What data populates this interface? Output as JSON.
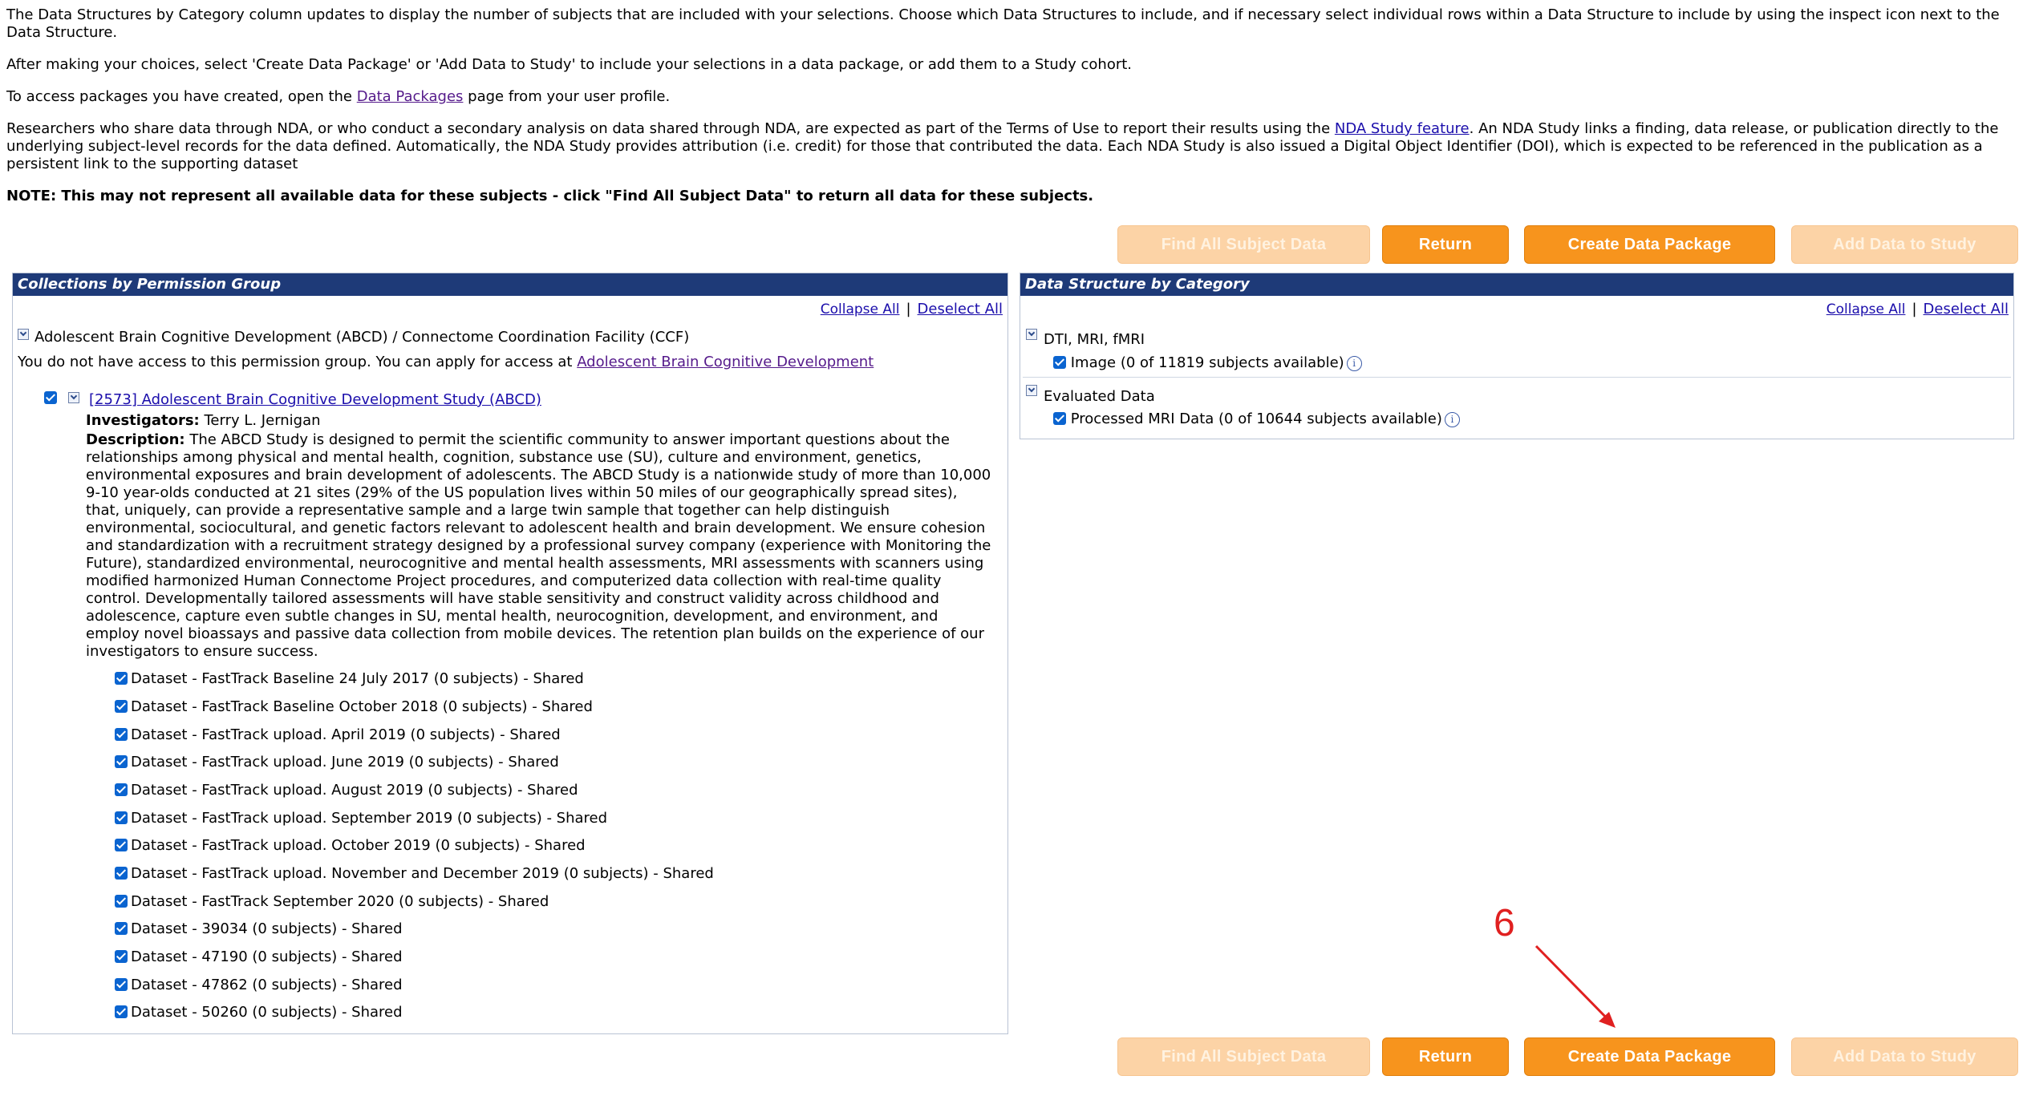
{
  "intro": {
    "p1": "The Data Structures by Category column updates to display the number of subjects that are included with your selections. Choose which Data Structures to include, and if necessary select individual rows within a Data Structure to include by using the inspect icon next to the Data Structure.",
    "p2": "After making your choices, select 'Create Data Package' or 'Add Data to Study' to include your selections in a data package, or add them to a Study cohort.",
    "p3_pre": "To access packages you have created, open the ",
    "p3_link": "Data Packages",
    "p3_post": " page from your user profile.",
    "p4_pre": "Researchers who share data through NDA, or who conduct a secondary analysis on data shared through NDA, are expected as part of the Terms of Use to report their results using the ",
    "p4_link": "NDA Study feature",
    "p4_post": ". An NDA Study links a finding, data release, or publication directly to the underlying subject-level records for the data defined. Automatically, the NDA Study provides attribution (i.e. credit) for those that contributed the data. Each NDA Study is also issued a Digital Object Identifier (DOI), which is expected to be referenced in the publication as a persistent link to the supporting dataset",
    "note": "NOTE: This may not represent all available data for these subjects - click \"Find All Subject Data\" to return all data for these subjects."
  },
  "buttons": {
    "find_all": "Find All Subject Data",
    "return": "Return",
    "create_package": "Create Data Package",
    "add_to_study": "Add Data to Study"
  },
  "left_panel": {
    "title": "Collections by Permission Group",
    "collapse_all": "Collapse All",
    "deselect_all": "Deselect All",
    "group_name": "Adolescent Brain Cognitive Development (ABCD) / Connectome Coordination Facility (CCF)",
    "access_pre": "You do not have access to this permission group. You can apply for access at ",
    "access_link": "Adolescent Brain Cognitive Development",
    "study_link": "[2573] Adolescent Brain Cognitive Development Study (ABCD)",
    "investigators_label": "Investigators:",
    "investigators_value": "Terry L. Jernigan",
    "description_label": "Description:",
    "description_value": "The ABCD Study is designed to permit the scientific community to answer important questions about the relationships among physical and mental health, cognition, substance use (SU), culture and environment, genetics, environmental exposures and brain development of adolescents. The ABCD Study is a nationwide study of more than 10,000 9-10 year-olds conducted at 21 sites (29% of the US population lives within 50 miles of our geographically spread sites), that, uniquely, can provide a representative sample and a large twin sample that together can help distinguish environmental, sociocultural, and genetic factors relevant to adolescent health and brain development. We ensure cohesion and standardization with a recruitment strategy designed by a professional survey company (experience with Monitoring the Future), standardized environmental, neurocognitive and mental health assessments, MRI assessments with scanners using modified harmonized Human Connectome Project procedures, and computerized data collection with real-time quality control. Developmentally tailored assessments will have stable sensitivity and construct validity across childhood and adolescence, capture even subtle changes in SU, mental health, neurocognition, development, and environment, and employ novel bioassays and passive data collection from mobile devices. The retention plan builds on the experience of our investigators to ensure success.",
    "datasets": [
      "Dataset - FastTrack Baseline 24 July 2017 (0 subjects) - Shared",
      "Dataset - FastTrack Baseline October 2018 (0 subjects) - Shared",
      "Dataset - FastTrack upload. April 2019 (0 subjects) - Shared",
      "Dataset - FastTrack upload. June 2019 (0 subjects) - Shared",
      "Dataset - FastTrack upload. August 2019 (0 subjects) - Shared",
      "Dataset - FastTrack upload. September 2019 (0 subjects) - Shared",
      "Dataset - FastTrack upload. October 2019 (0 subjects) - Shared",
      "Dataset - FastTrack upload. November and December 2019 (0 subjects) - Shared",
      "Dataset - FastTrack September 2020 (0 subjects) - Shared",
      "Dataset - 39034 (0 subjects) - Shared",
      "Dataset - 47190 (0 subjects) - Shared",
      "Dataset - 47862 (0 subjects) - Shared",
      "Dataset - 50260 (0 subjects) - Shared"
    ]
  },
  "right_panel": {
    "title": "Data Structure by Category",
    "collapse_all": "Collapse All",
    "deselect_all": "Deselect All",
    "cat1": "DTI, MRI, fMRI",
    "cat1_item": "Image (0 of 11819 subjects available)",
    "cat2": "Evaluated Data",
    "cat2_item": "Processed MRI Data (0 of 10644 subjects available)"
  },
  "annotation": {
    "step": "6",
    "color": "#e02020"
  },
  "colors": {
    "accent": "#f7941d",
    "header": "#1e3a78",
    "checkbox": "#0a64d0"
  }
}
